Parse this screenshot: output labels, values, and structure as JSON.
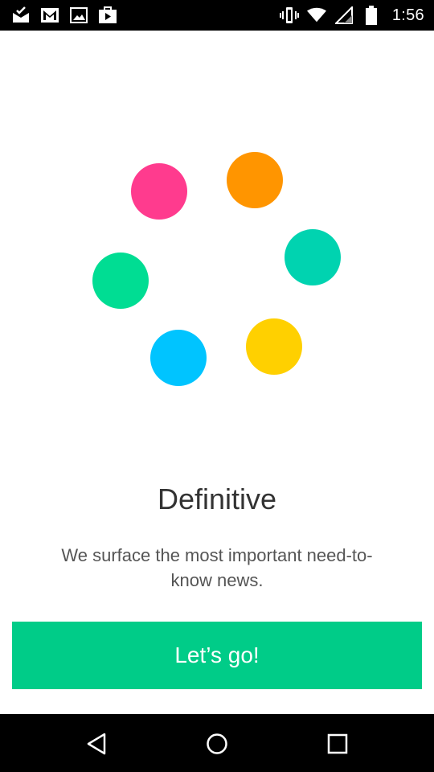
{
  "status_bar": {
    "time": "1:56",
    "left_icons": [
      "mail-check-icon",
      "gmail-icon",
      "gallery-icon",
      "play-store-icon"
    ],
    "right_icons": [
      "vibrate-icon",
      "wifi-icon",
      "signal-icon",
      "battery-icon"
    ]
  },
  "illustration": {
    "dots": [
      {
        "name": "dot-pink",
        "color": "#ff3b8e"
      },
      {
        "name": "dot-orange",
        "color": "#ff9500"
      },
      {
        "name": "dot-teal",
        "color": "#00d3b0"
      },
      {
        "name": "dot-green",
        "color": "#00dd93"
      },
      {
        "name": "dot-blue",
        "color": "#00c4ff"
      },
      {
        "name": "dot-yellow",
        "color": "#ffd000"
      }
    ]
  },
  "onboarding": {
    "title": "Definitive",
    "description": "We surface the most important need-to-know news.",
    "cta_label": "Let’s go!",
    "accent_color": "#00cc88"
  },
  "nav_bar": {
    "buttons": [
      "back-icon",
      "home-icon",
      "recents-icon"
    ]
  }
}
